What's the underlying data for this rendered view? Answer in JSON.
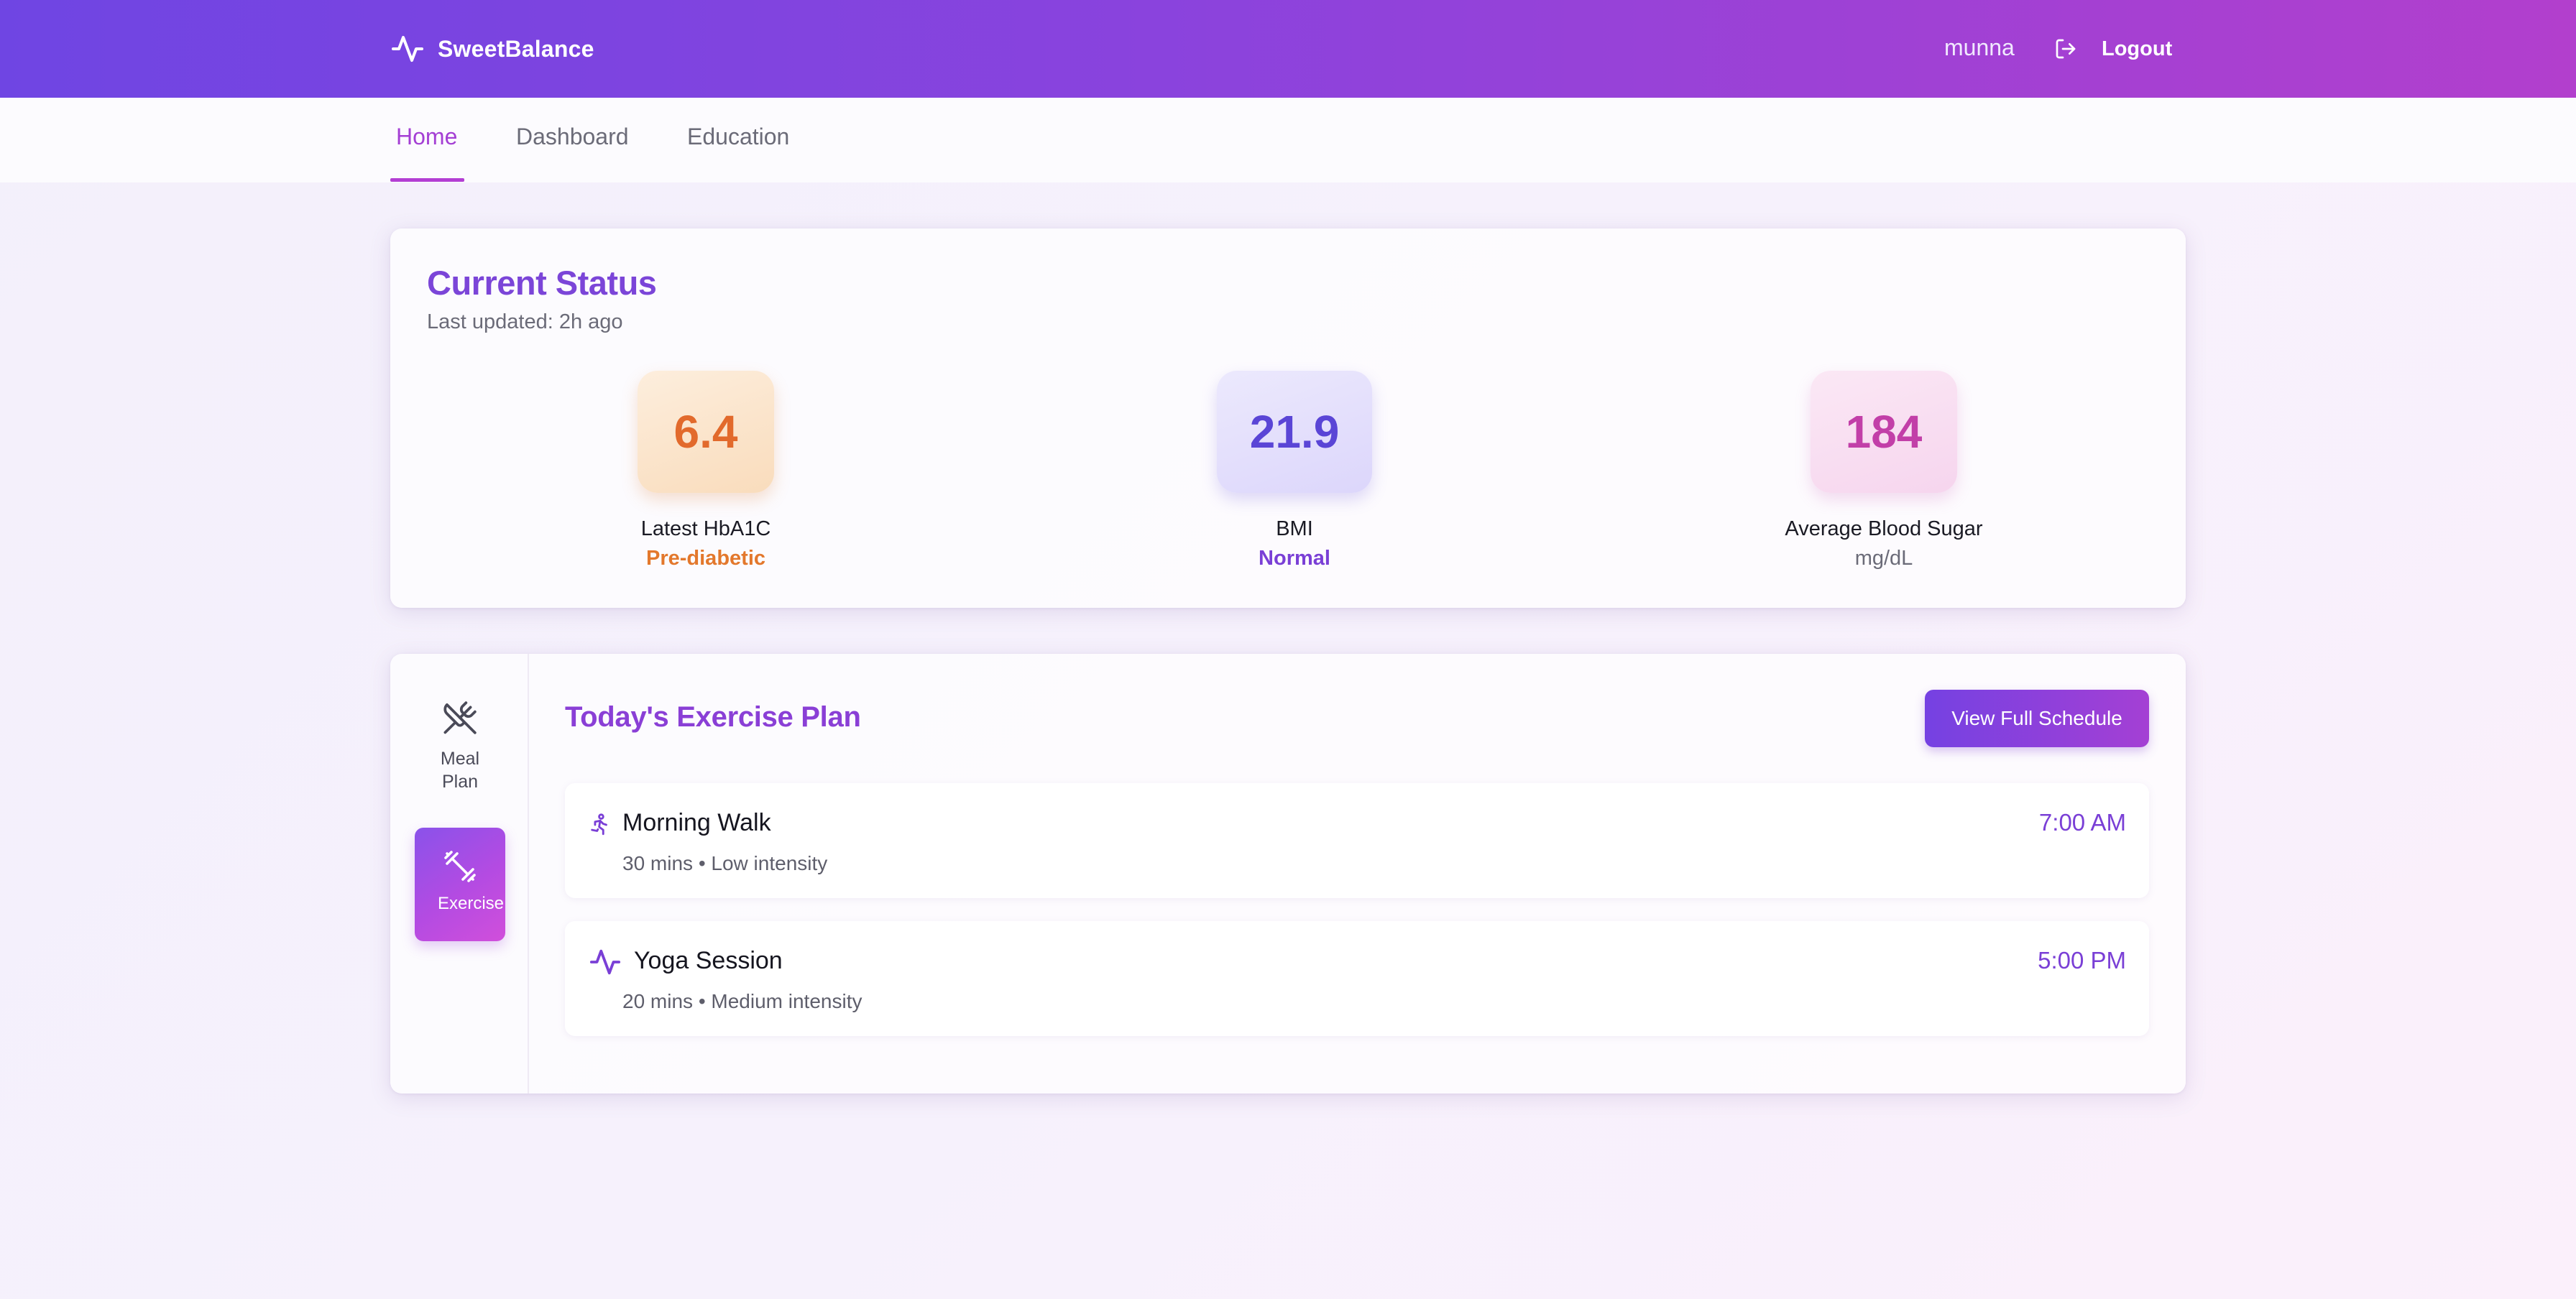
{
  "header": {
    "brand": "SweetBalance",
    "brand_icon": "activity-pulse-icon",
    "user": "munna",
    "logout_label": "Logout",
    "logout_icon": "logout-icon",
    "gradient": [
      "#6f45e3",
      "#b23fcd"
    ]
  },
  "nav": {
    "tabs": [
      {
        "label": "Home",
        "active": true
      },
      {
        "label": "Dashboard",
        "active": false
      },
      {
        "label": "Education",
        "active": false
      }
    ],
    "accent": "#a43fd4"
  },
  "status": {
    "title": "Current Status",
    "updated": "Last updated: 2h ago",
    "metrics": [
      {
        "value": "6.4",
        "label": "Latest HbA1C",
        "sub": "Pre-diabetic",
        "color": "#e26a2c"
      },
      {
        "value": "21.9",
        "label": "BMI",
        "sub": "Normal",
        "color": "#5a45d6"
      },
      {
        "value": "184",
        "label": "Average Blood Sugar",
        "sub": "mg/dL",
        "color": "#c23fa8"
      }
    ]
  },
  "sidebar": {
    "items": [
      {
        "label": "Meal Plan",
        "icon": "utensils-crossed-icon",
        "active": false
      },
      {
        "label": "Exercise",
        "icon": "dumbbell-icon",
        "active": true
      }
    ]
  },
  "exercise": {
    "title": "Today's Exercise Plan",
    "button": "View Full Schedule",
    "items": [
      {
        "name": "Morning Walk",
        "meta": "30 mins • Low intensity",
        "time": "7:00 AM",
        "icon": "walking-person-icon"
      },
      {
        "name": "Yoga Session",
        "meta": "20 mins • Medium intensity",
        "time": "5:00 PM",
        "icon": "activity-pulse-icon"
      }
    ]
  }
}
